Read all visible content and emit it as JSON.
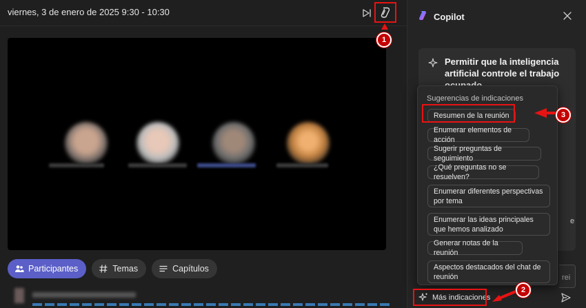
{
  "meeting": {
    "title": "viernes, 3 de enero de 2025 9:30 - 10:30"
  },
  "tabs": [
    {
      "label": "Participantes",
      "icon": "people-icon",
      "active": true
    },
    {
      "label": "Temas",
      "icon": "hashtag-icon",
      "active": false
    },
    {
      "label": "Capítulos",
      "icon": "list-icon",
      "active": false
    }
  ],
  "copilot": {
    "title": "Copilot",
    "card_text": "Permitir que la inteligencia artificial controle el trabajo ocupado",
    "card_fragment": "e",
    "input_fragment": "rei",
    "suggestions_heading": "Sugerencias de indicaciones",
    "suggestions": [
      "Resumen de la reunión",
      "Enumerar elementos de acción",
      "Sugerir preguntas de seguimiento",
      "¿Qué preguntas no se resuelven?",
      "Enumerar diferentes perspectivas por tema",
      "Enumerar las ideas principales que hemos analizado",
      "Generar notas de la reunión",
      "Aspectos destacados del chat de reunión"
    ],
    "more_label": "Más indicaciones"
  },
  "annotations": {
    "markers": [
      "1",
      "2",
      "3"
    ],
    "color": "#e81313"
  },
  "colors": {
    "accent": "#5b5fc7",
    "background": "#1f1f1f",
    "panel": "#242424"
  }
}
